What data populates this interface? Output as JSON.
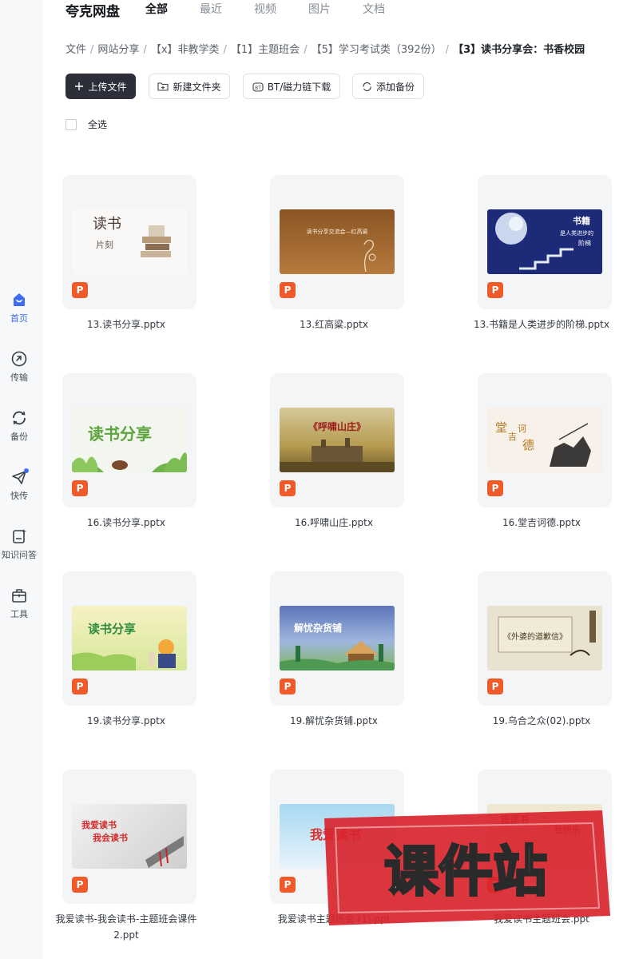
{
  "app": {
    "brand": "夸克网盘"
  },
  "tabs": [
    {
      "label": "全部",
      "active": true
    },
    {
      "label": "最近"
    },
    {
      "label": "视频"
    },
    {
      "label": "图片"
    },
    {
      "label": "文档"
    }
  ],
  "breadcrumb": [
    "文件",
    "网站分享",
    "【x】非教学类",
    "【1】主题班会",
    "【5】学习考试类（392份）",
    "【3】读书分享会：书香校园"
  ],
  "toolbar": {
    "upload": "上传文件",
    "new_folder": "新建文件夹",
    "bt_download": "BT/磁力链下载",
    "add_backup": "添加备份"
  },
  "select_all": "全选",
  "sidebar": [
    {
      "label": "首页",
      "icon": "home-smile-icon",
      "active": true
    },
    {
      "label": "传输",
      "icon": "transfer-icon"
    },
    {
      "label": "备份",
      "icon": "backup-sync-icon"
    },
    {
      "label": "快传",
      "icon": "paper-plane-icon",
      "badge_dot": true
    },
    {
      "label": "知识问答",
      "icon": "knowledge-qa-icon"
    },
    {
      "label": "工具",
      "icon": "toolbox-icon"
    }
  ],
  "files": [
    {
      "name": "13.读书分享.pptx",
      "thumb_text": "读书 片刻",
      "type": "ppt"
    },
    {
      "name": "13.红高粱.pptx",
      "thumb_text": "读书分享交流会—红高粱",
      "type": "ppt"
    },
    {
      "name": "13.书籍是人类进步的阶梯.pptx",
      "thumb_text": "书籍 是人类进步的 阶梯",
      "type": "ppt"
    },
    {
      "name": "16.读书分享.pptx",
      "thumb_text": "读书分享",
      "type": "ppt"
    },
    {
      "name": "16.呼啸山庄.pptx",
      "thumb_text": "《呼啸山庄》",
      "type": "ppt"
    },
    {
      "name": "16.堂吉诃德.pptx",
      "thumb_text": "堂吉诃德",
      "type": "ppt"
    },
    {
      "name": "19.读书分享.pptx",
      "thumb_text": "读书分享",
      "type": "ppt"
    },
    {
      "name": "19.解忧杂货铺.pptx",
      "thumb_text": "解忧杂货铺",
      "type": "ppt"
    },
    {
      "name": "19.乌合之众(02).pptx",
      "thumb_text": "《外婆的道歉信》",
      "type": "ppt"
    },
    {
      "name": "我爱读书-我会读书-主题班会课件2.ppt",
      "thumb_text": "我爱读书 我会读书",
      "type": "ppt"
    },
    {
      "name": "我爱读书主题班会 (1).ppt",
      "thumb_text": "我爱读书",
      "type": "ppt"
    },
    {
      "name": "我爱读书主题班会.ppt",
      "thumb_text": "我读书 我快乐",
      "type": "ppt"
    }
  ],
  "watermark": {
    "text": "课件站"
  },
  "colors": {
    "accent": "#3f6cf0",
    "primary_button": "#2c2f3a",
    "ppt_badge": "#f05a28",
    "watermark_red": "#d8252e"
  }
}
